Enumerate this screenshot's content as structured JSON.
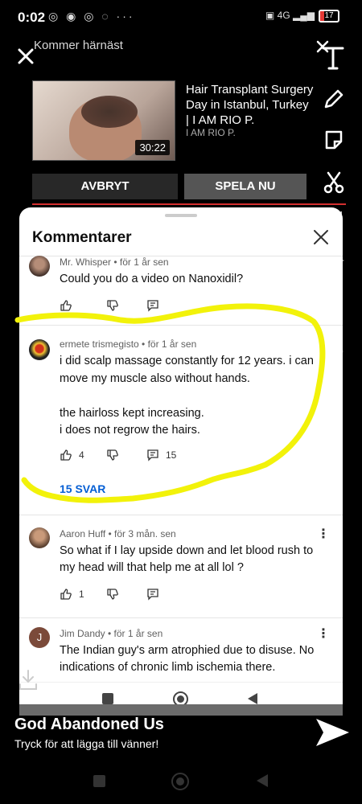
{
  "status_bar": {
    "time": "0:02",
    "battery": "17"
  },
  "header": {
    "coming_soon": "Kommer härnäst",
    "video_title": "Hair Transplant Surgery Day in Istanbul, Turkey | I AM RIO P.",
    "channel": "I AM RIO P.",
    "duration": "30:22",
    "cancel_label": "AVBRYT",
    "play_label": "SPELA NU"
  },
  "comments_panel": {
    "title": "Kommentarer",
    "comments": [
      {
        "author_meta": "Mr. Whisper • för 1 år sen",
        "text": "Could you do a video on Nanoxidil?",
        "likes": "",
        "reply_count": ""
      },
      {
        "author_meta": "ermete trismegisto • för 1 år sen",
        "text": "i did scalp massage constantly for 12 years. i can move my muscle also without hands.\n\n the hairloss kept increasing.\ni does not regrow the hairs.",
        "likes": "4",
        "reply_count": "15",
        "replies_label": "15 SVAR"
      },
      {
        "author_meta": "Aaron Huff • för 3 mån. sen",
        "text": "So what if I lay upside down and let blood rush to my head will that help me at all lol ?",
        "likes": "1",
        "reply_count": ""
      },
      {
        "author_meta": "Jim Dandy • för 1 år sen",
        "avatar_letter": "J",
        "text": "The Indian guy's arm atrophied due to disuse. No indications of chronic limb ischemia there.",
        "likes": "",
        "reply_count": ""
      }
    ]
  },
  "footer": {
    "title": "God Abandoned Us",
    "subtitle": "Tryck för att lägga till vänner!"
  },
  "colors": {
    "link_blue": "#065fd4",
    "annotation_yellow": "#f2f20a",
    "progress_red": "#d32f2f"
  }
}
